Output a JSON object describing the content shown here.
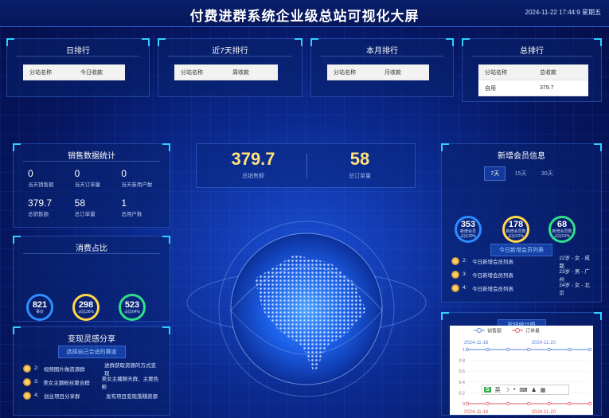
{
  "header": {
    "title": "付费进群系统企业级总站可视化大屏",
    "datetime": "2024-11-22 17:44:9 星期五"
  },
  "rankings": [
    {
      "title": "日排行",
      "col1": "分站名称",
      "col2": "今日收款",
      "rows": []
    },
    {
      "title": "近7天排行",
      "col1": "分站名称",
      "col2": "周收款",
      "rows": []
    },
    {
      "title": "本月排行",
      "col1": "分站名称",
      "col2": "月收款",
      "rows": []
    },
    {
      "title": "总排行",
      "col1": "分站名称",
      "col2": "总收款",
      "rows": [
        {
          "name": "自用",
          "value": "379.7"
        }
      ]
    }
  ],
  "sales_stats": {
    "title": "销售数据统计",
    "items": [
      {
        "value": "0",
        "label": "当天销售额"
      },
      {
        "value": "0",
        "label": "当天订单量"
      },
      {
        "value": "0",
        "label": "当天新用户数"
      },
      {
        "value": "379.7",
        "label": "总销售额"
      },
      {
        "value": "58",
        "label": "总订单量"
      },
      {
        "value": "1",
        "label": "总用户数"
      }
    ]
  },
  "consumption": {
    "title": "消费占比",
    "rings": [
      {
        "value": "821",
        "label": "事价",
        "color": "#2f8cff"
      },
      {
        "value": "298",
        "label": "占比36%",
        "color": "#ffd84a"
      },
      {
        "value": "523",
        "label": "占比64%",
        "color": "#2fe08a"
      }
    ]
  },
  "share": {
    "title": "变现灵感分享",
    "button": "选择自己合适的赛道",
    "rows": [
      {
        "rank": "2:",
        "name": "视频图片做资源群",
        "desc": "进群获取资源的方式变现"
      },
      {
        "rank": "3:",
        "name": "美女主题粉丝聚合群",
        "desc": "美女主播聊天群、主要色粉"
      },
      {
        "rank": "4:",
        "name": "创业项目分享群",
        "desc": "发布项目变现落赚资源"
      }
    ]
  },
  "center": {
    "sales_value": "379.7",
    "sales_label": "总销售额",
    "orders_value": "58",
    "orders_label": "总订单量"
  },
  "new_members": {
    "title": "新增会员信息",
    "tabs": [
      "7天",
      "15天",
      "30天"
    ],
    "active_tab": "7天",
    "rings": [
      {
        "value": "353",
        "label1": "新增会员",
        "label2": "占比30%",
        "color": "#2f8cff"
      },
      {
        "value": "178",
        "label1": "新增会员数",
        "label2": "占比52%",
        "color": "#ffd84a"
      },
      {
        "value": "68",
        "label1": "新增会员数",
        "label2": "占比52%",
        "color": "#2fe08a"
      }
    ],
    "list_button": "今日新增会员列表",
    "rows": [
      {
        "rank": "2:",
        "name": "今日新增会员列表",
        "info": "22岁 - 女 - 成都"
      },
      {
        "rank": "3:",
        "name": "今日新增会员列表",
        "info": "23岁 - 男 - 广州"
      },
      {
        "rank": "4:",
        "name": "今日新增会员列表",
        "info": "24岁 - 女 - 北京"
      }
    ]
  },
  "line_chart": {
    "title": "折线统计图",
    "legend": [
      "销售额",
      "订单量"
    ],
    "date1": "2024-11-16",
    "date2": "2024-11-20",
    "yticks": [
      "1",
      "0.8",
      "0.6",
      "0.4",
      "0.2",
      "0"
    ],
    "ime_label": "英"
  },
  "chart_data": {
    "type": "line",
    "series": [
      {
        "name": "销售额",
        "values": [
          1,
          1,
          1,
          1,
          1,
          1,
          1
        ]
      },
      {
        "name": "订单量",
        "values": [
          0,
          0,
          0,
          0,
          0,
          0,
          0
        ]
      }
    ],
    "x": [
      "2024-11-16",
      "",
      "",
      "",
      "2024-11-20",
      "",
      ""
    ],
    "ylim": [
      0,
      1
    ]
  }
}
